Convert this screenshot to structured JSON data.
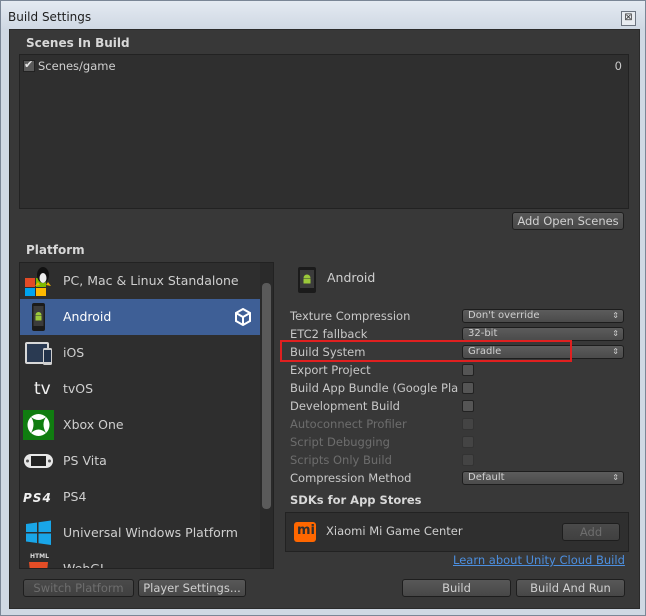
{
  "window": {
    "title": "Build Settings",
    "close_glyph": "⊠"
  },
  "scenes": {
    "header": "Scenes In Build",
    "items": [
      {
        "name": "Scenes/game",
        "index": "0",
        "checked": true
      }
    ],
    "add_open_scenes_label": "Add Open Scenes"
  },
  "platform": {
    "header": "Platform",
    "items": [
      {
        "label": "PC, Mac & Linux Standalone",
        "icon": "pc-mac-linux-icon"
      },
      {
        "label": "Android",
        "icon": "android-icon",
        "selected": true,
        "active_badge": "unity-icon"
      },
      {
        "label": "iOS",
        "icon": "ios-icon"
      },
      {
        "label": "tvOS",
        "icon": "tvos-icon"
      },
      {
        "label": "Xbox One",
        "icon": "xbox-icon"
      },
      {
        "label": "PS Vita",
        "icon": "ps-vita-icon"
      },
      {
        "label": "PS4",
        "icon": "ps4-icon"
      },
      {
        "label": "Universal Windows Platform",
        "icon": "windows-icon"
      },
      {
        "label": "WebGL",
        "icon": "html5-icon"
      }
    ],
    "tvos_glyph_text": "tv",
    "ps4_logo_text": "PS4",
    "html_logo_text": "HTML"
  },
  "settings": {
    "platform_title": "Android",
    "rows": {
      "texture_compression": {
        "label": "Texture Compression",
        "value": "Don't override"
      },
      "etc2_fallback": {
        "label": "ETC2 fallback",
        "value": "32-bit"
      },
      "build_system": {
        "label": "Build System",
        "value": "Gradle"
      },
      "export_project": {
        "label": "Export Project"
      },
      "build_app_bundle": {
        "label": "Build App Bundle (Google Pla"
      },
      "development_build": {
        "label": "Development Build"
      },
      "autoconnect_profiler": {
        "label": "Autoconnect Profiler"
      },
      "script_debugging": {
        "label": "Script Debugging"
      },
      "scripts_only_build": {
        "label": "Scripts Only Build"
      },
      "compression_method": {
        "label": "Compression Method",
        "value": "Default"
      }
    },
    "dropdown_arrow": "⇕",
    "sdk_header": "SDKs for App Stores",
    "sdk": {
      "logo_text": "mi",
      "name": "Xiaomi Mi Game Center",
      "add_label": "Add"
    },
    "cloud_link": "Learn about Unity Cloud Build"
  },
  "footer": {
    "switch_platform": "Switch Platform",
    "player_settings": "Player Settings...",
    "build": "Build",
    "build_and_run": "Build And Run"
  },
  "colors": {
    "selection": "#3e5f96",
    "highlight_box": "#e02020",
    "link": "#4c8fe0"
  }
}
